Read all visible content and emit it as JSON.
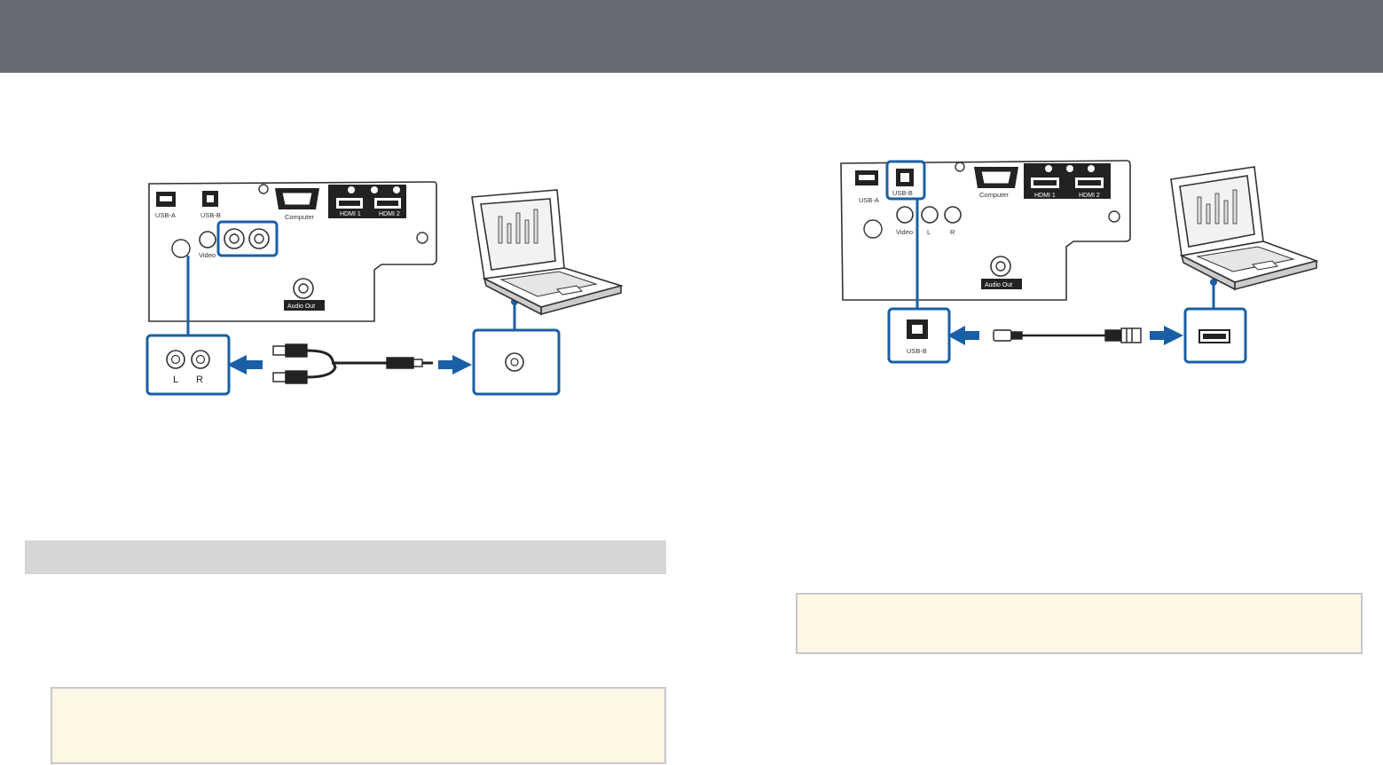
{
  "colors": {
    "header": "#666a72",
    "accent_blue": "#1a5fa5",
    "section_bar": "#d6d6d6",
    "note_bg": "#fdf7e6",
    "note_border": "#c8c8c8"
  },
  "diagram_audio": {
    "ports": {
      "usb_a": "USB-A",
      "usb_b": "USB-B",
      "computer": "Computer",
      "hdmi1": "HDMI 1",
      "hdmi2": "HDMI 2",
      "video": "Video",
      "audio_out": "Audio Out"
    },
    "callout": {
      "left": "L",
      "right": "R"
    }
  },
  "diagram_usb": {
    "ports": {
      "usb_a": "USB-A",
      "usb_b": "USB-B",
      "computer": "Computer",
      "hdmi1": "HDMI 1",
      "hdmi2": "HDMI 2",
      "video": "Video",
      "left": "L",
      "right": "R",
      "audio_out": "Audio Out"
    },
    "callout": {
      "usb_b": "USB-B"
    }
  }
}
